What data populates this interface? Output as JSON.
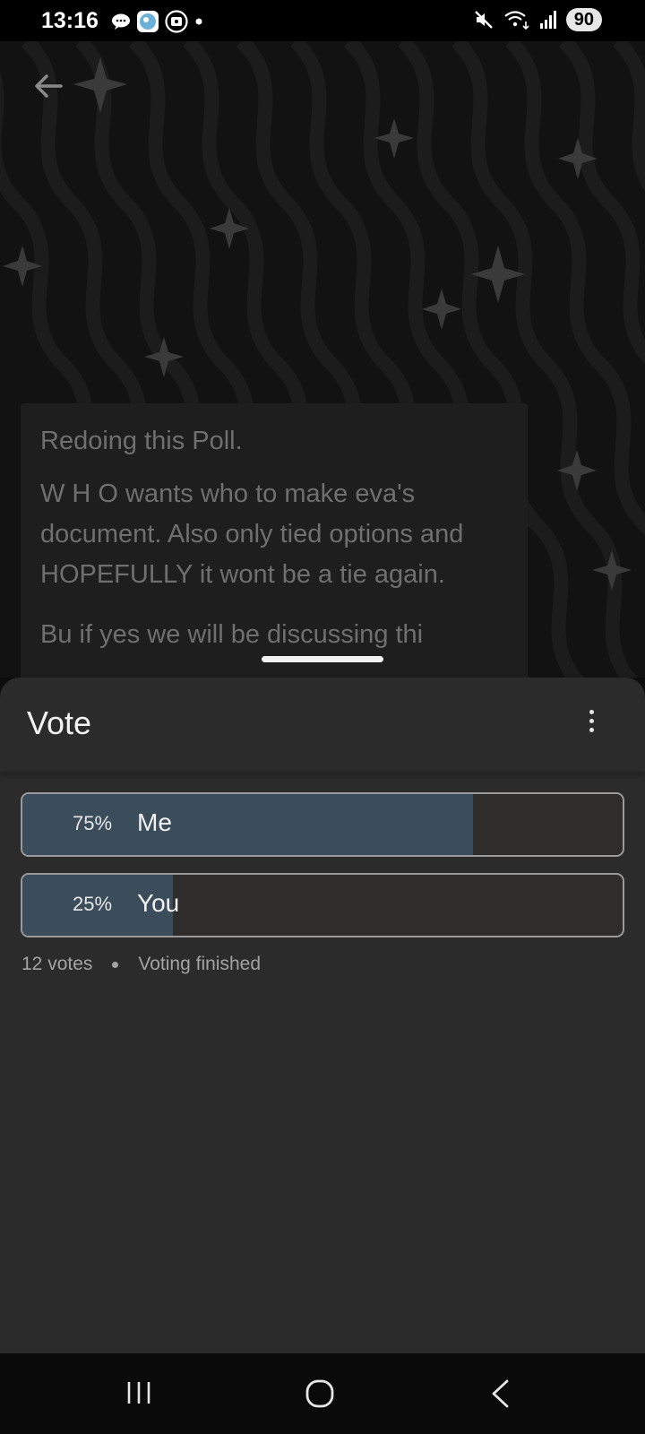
{
  "status_bar": {
    "time": "13:16",
    "battery": "90",
    "notification_icons": [
      "chat-bubble-icon",
      "avatar-app-icon",
      "app-icon",
      "dot-icon"
    ],
    "system_icons": [
      "mute-icon",
      "wifi-icon",
      "signal-icon"
    ]
  },
  "background": {
    "pattern": "wavy-stars",
    "back_icon": "arrow-left-icon"
  },
  "post": {
    "paragraph_1": "Redoing this Poll.",
    "paragraph_2": "W H O wants who to make eva's document. Also only tied options and HOPEFULLY it wont be a tie again.",
    "paragraph_3": "Bu if yes we will be discussing thi"
  },
  "poll": {
    "title": "Vote",
    "menu_icon": "more-vertical-icon",
    "options": [
      {
        "percent_label": "75%",
        "label": "Me",
        "fraction": 0.75
      },
      {
        "percent_label": "25%",
        "label": "You",
        "fraction": 0.25
      }
    ],
    "votes": "12 votes",
    "status": "Voting finished"
  },
  "colors": {
    "sheet_bg": "#2b2b2b",
    "bar_fill": "#3b4d5b",
    "bar_border": "#9a9a9a"
  },
  "nav_bar": {
    "icons": [
      "recent-apps-icon",
      "home-icon",
      "back-icon"
    ]
  }
}
